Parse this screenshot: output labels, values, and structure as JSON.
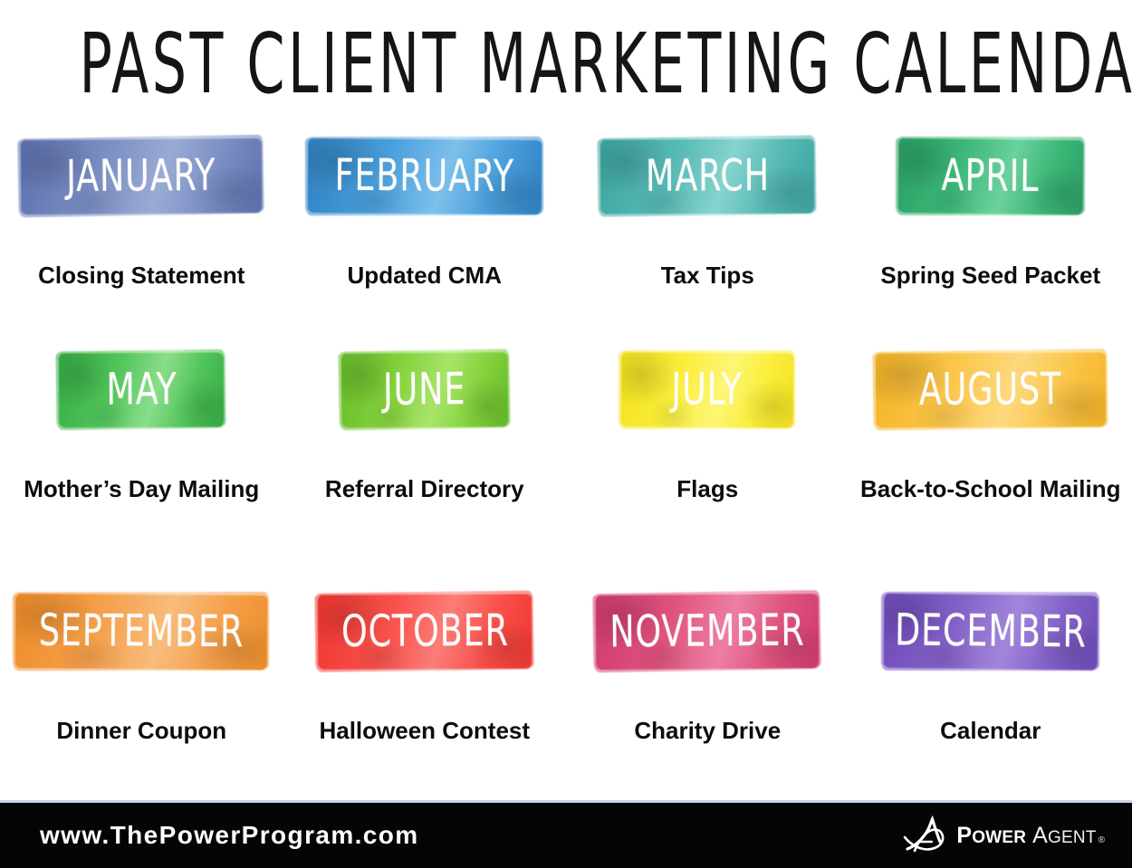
{
  "poster": {
    "title": "PAST CLIENT MARKETING CALENDAR",
    "background_color": "#ffffff"
  },
  "months": [
    {
      "month": "JANUARY",
      "caption": "Closing Statement",
      "color": "#7b8fc4",
      "color_dark": "#5c6fae",
      "color_light": "#9aaad5"
    },
    {
      "month": "FEBRUARY",
      "caption": "Updated CMA",
      "color": "#4a9fdc",
      "color_dark": "#2e7fc0",
      "color_light": "#7cc0ec"
    },
    {
      "month": "MARCH",
      "caption": "Tax Tips",
      "color": "#56b9b4",
      "color_dark": "#3ba49f",
      "color_light": "#86d3cf"
    },
    {
      "month": "APRIL",
      "caption": "Spring Seed Packet",
      "color": "#3cb878",
      "color_dark": "#2a9d63",
      "color_light": "#6bd19d"
    },
    {
      "month": "MAY",
      "caption": "Mother’s Day Mailing",
      "color": "#51c45a",
      "color_dark": "#33ab42",
      "color_light": "#8ade8a"
    },
    {
      "month": "JUNE",
      "caption": "Referral Directory",
      "color": "#84d23c",
      "color_dark": "#64bb28",
      "color_light": "#a9e46a"
    },
    {
      "month": "JULY",
      "caption": "Flags",
      "color": "#fbee3a",
      "color_dark": "#f2e01c",
      "color_light": "#fdf676"
    },
    {
      "month": "AUGUST",
      "caption": "Back-to-School Mailing",
      "color": "#fbc64a",
      "color_dark": "#f4b225",
      "color_light": "#fdd97e"
    },
    {
      "month": "SEPTEMBER",
      "caption": "Dinner Coupon",
      "color": "#f5a04a",
      "color_dark": "#ef8c28",
      "color_light": "#f8bc7d"
    },
    {
      "month": "OCTOBER",
      "caption": "Halloween Contest",
      "color": "#f9504a",
      "color_dark": "#ef3530",
      "color_light": "#fb7d78"
    },
    {
      "month": "NOVEMBER",
      "caption": "Charity Drive",
      "color": "#e0537f",
      "color_dark": "#ce3a6b",
      "color_light": "#ed7fa2"
    },
    {
      "month": "DECEMBER",
      "caption": "Calendar",
      "color": "#8361c8",
      "color_dark": "#6d49b8",
      "color_light": "#a186da"
    }
  ],
  "footer": {
    "url": "www.ThePowerProgram.com",
    "logo_power": "Power",
    "logo_power_small": "OWER",
    "logo_power_cap": "P",
    "logo_agent_cap": "A",
    "logo_agent_small": "GENT",
    "logo_registered": "®",
    "bar_color": "#050507",
    "rule_color": "#c8d4e6"
  }
}
